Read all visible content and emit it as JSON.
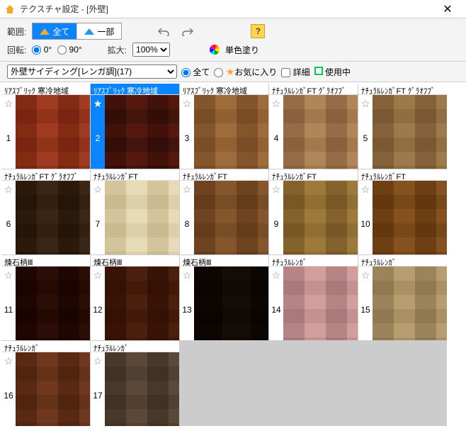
{
  "window": {
    "title": "テクスチャ設定 - [外壁]"
  },
  "toolbar": {
    "range_label": "範囲:",
    "range_all": "全て",
    "range_part": "一部",
    "rotate_label": "回転:",
    "rotate_0": "0°",
    "rotate_90": "90°",
    "zoom_label": "拡大:",
    "zoom_value": "100%",
    "solid_fill": "単色塗り"
  },
  "filter": {
    "category": "外壁サイディング[レンガ調](17)",
    "all": "全て",
    "favorite": "お気に入り",
    "detail": "詳細",
    "in_use": "使用中"
  },
  "items": [
    {
      "n": 1,
      "name": "ﾘｱｽﾌﾞﾘｯｸ 寒冷地域",
      "cls": "brick1",
      "sel": false
    },
    {
      "n": 2,
      "name": "ﾘｱｽﾌﾞﾘｯｸ 寒冷地域",
      "cls": "brick2",
      "sel": true
    },
    {
      "n": 3,
      "name": "ﾘｱｽﾌﾞﾘｯｸ 寒冷地域",
      "cls": "brick3",
      "sel": false
    },
    {
      "n": 4,
      "name": "ﾅﾁｭﾗﾙﾚﾝｶﾞFT ｸﾞﾗｵﾌﾌﾞ",
      "cls": "brick4",
      "sel": false
    },
    {
      "n": 5,
      "name": "ﾅﾁｭﾗﾙﾚﾝｶﾞFT ｸﾞﾗｵﾌﾌﾞ",
      "cls": "brick5",
      "sel": false
    },
    {
      "n": 6,
      "name": "ﾅﾁｭﾗﾙﾚﾝｶﾞFT ｸﾞﾗｵﾌﾌﾞ",
      "cls": "brick6",
      "sel": false
    },
    {
      "n": 7,
      "name": "ﾅﾁｭﾗﾙﾚﾝｶﾞFT",
      "cls": "brick7",
      "sel": false
    },
    {
      "n": 8,
      "name": "ﾅﾁｭﾗﾙﾚﾝｶﾞFT",
      "cls": "brick8",
      "sel": false
    },
    {
      "n": 9,
      "name": "ﾅﾁｭﾗﾙﾚﾝｶﾞFT",
      "cls": "brick9",
      "sel": false
    },
    {
      "n": 10,
      "name": "ﾅﾁｭﾗﾙﾚﾝｶﾞFT",
      "cls": "brick10",
      "sel": false
    },
    {
      "n": 11,
      "name": "煉石柄Ⅲ",
      "cls": "brick11",
      "sel": false
    },
    {
      "n": 12,
      "name": "煉石柄Ⅲ",
      "cls": "brick12",
      "sel": false
    },
    {
      "n": 13,
      "name": "煉石柄Ⅲ",
      "cls": "brick13",
      "sel": false
    },
    {
      "n": 14,
      "name": "ﾅﾁｭﾗﾙﾚﾝｶﾞ",
      "cls": "brick14",
      "sel": false
    },
    {
      "n": 15,
      "name": "ﾅﾁｭﾗﾙﾚﾝｶﾞ",
      "cls": "brick15",
      "sel": false
    },
    {
      "n": 16,
      "name": "ﾅﾁｭﾗﾙﾚﾝｶﾞ",
      "cls": "brick16",
      "sel": false
    },
    {
      "n": 17,
      "name": "ﾅﾁｭﾗﾙﾚﾝｶﾞ",
      "cls": "brick17",
      "sel": false
    }
  ]
}
